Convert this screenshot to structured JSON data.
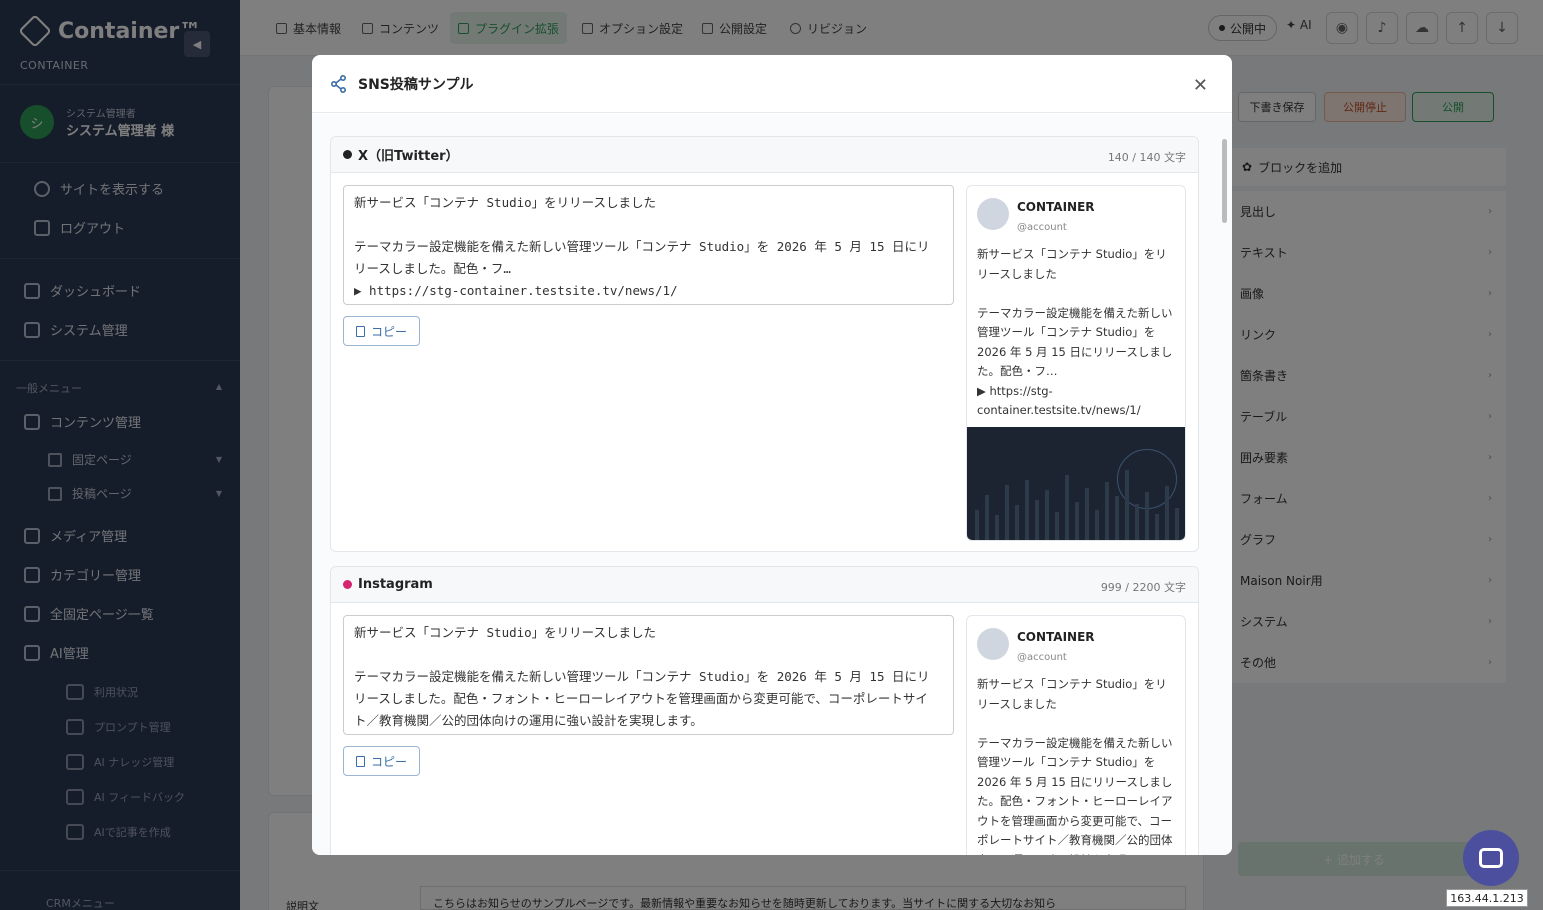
{
  "app": {
    "logo_text": "Container™",
    "logo_sub": "CONTAINER"
  },
  "user": {
    "role": "システム管理者",
    "name": "システム管理者 様",
    "avatar_char": "シ"
  },
  "sidebar": {
    "top_links": [
      {
        "label": "サイトを表示する"
      },
      {
        "label": "ログアウト"
      }
    ],
    "main_items": [
      {
        "label": "ダッシュボード"
      },
      {
        "label": "システム管理"
      }
    ],
    "group_label": "一般メニュー",
    "menu": [
      {
        "label": "コンテンツ管理"
      },
      {
        "label": "固定ページ"
      },
      {
        "label": "投稿ページ"
      },
      {
        "label": "メディア管理"
      },
      {
        "label": "カテゴリー管理"
      },
      {
        "label": "全固定ページ一覧"
      },
      {
        "label": "AI管理"
      },
      {
        "label": "利用状況"
      },
      {
        "label": "プロンプト管理"
      },
      {
        "label": "AI ナレッジ管理"
      },
      {
        "label": "AI フィードバック"
      },
      {
        "label": "AIで記事を作成"
      }
    ],
    "crm_label": "CRMメニュー"
  },
  "topbar": {
    "tabs": [
      {
        "label": "基本情報"
      },
      {
        "label": "コンテンツ"
      },
      {
        "label": "プラグイン拡張"
      },
      {
        "label": "オプション設定"
      },
      {
        "label": "公開設定"
      },
      {
        "label": "リビジョン"
      }
    ],
    "status": "公開中",
    "ai_label": "AI"
  },
  "right_panel": {
    "draft_label": "下書き保存",
    "unpublish_label": "公開停止",
    "publish_label": "公開",
    "add_block_label": "ブロックを追加",
    "blocks": [
      {
        "label": "見出し"
      },
      {
        "label": "テキスト"
      },
      {
        "label": "画像"
      },
      {
        "label": "リンク"
      },
      {
        "label": "箇条書き"
      },
      {
        "label": "テーブル"
      },
      {
        "label": "囲み要素"
      },
      {
        "label": "フォーム"
      },
      {
        "label": "グラフ"
      },
      {
        "label": "Maison Noir用"
      },
      {
        "label": "システム"
      },
      {
        "label": "その他"
      }
    ],
    "add_button_label": "+ 追加する"
  },
  "background": {
    "desc_label": "説明文",
    "desc_text": "こちらはお知らせのサンプルページです。最新情報や重要なお知らせを随時更新しております。当サイトに関する大切なお知ら"
  },
  "modal": {
    "title": "SNS投稿サンプル",
    "cards": [
      {
        "platform": "X（旧Twitter）",
        "count": "140 / 140 文字",
        "dot_color": "#222222",
        "text": "新サービス「コンテナ Studio」をリリースしました\n\nテーマカラー設定機能を備えた新しい管理ツール「コンテナ Studio」を 2026 年 5 月 15 日にリリースしました。配色・フ…\n▶ https://stg-container.testsite.tv/news/1/",
        "copy_label": "コピー",
        "preview_name": "CONTAINER",
        "preview_account": "@account",
        "preview_text": "新サービス「コンテナ Studio」をリリースしました\n\nテーマカラー設定機能を備えた新しい管理ツール「コンテナ Studio」を 2026 年 5 月 15 日にリリースしました。配色・フ…\n▶ https://stg-container.testsite.tv/news/1/"
      },
      {
        "platform": "Instagram",
        "count": "999 / 2200 文字",
        "dot_color": "#d6246e",
        "text": "新サービス「コンテナ Studio」をリリースしました\n\nテーマカラー設定機能を備えた新しい管理ツール「コンテナ Studio」を 2026 年 5 月 15 日にリリースしました。配色・フォント・ヒーローレイアウトを管理画面から変更可能で、コーポレートサイト／教育機関／公的団体向けの運用に強い設計を実現します。",
        "copy_label": "コピー",
        "preview_name": "CONTAINER",
        "preview_account": "@account",
        "preview_text": "新サービス「コンテナ Studio」をリリースしました\n\nテーマカラー設定機能を備えた新しい管理ツール「コンテナ Studio」を 2026 年 5 月 15 日にリリースしました。配色・フォント・ヒーローレイアウトを管理画面から変更可能で、コーポレートサイト／教育機関／公的団体向けの運用に強い設計を実現"
      }
    ]
  },
  "ip_tag": "163.44.1.213",
  "colors": {
    "accent": "#2e9e5b",
    "sidebar": "#2c3a55",
    "bot": "#4b4f9e"
  },
  "icons": {
    "share": "share-icon",
    "close": "close-icon",
    "copy": "copy-icon",
    "bot": "chatbot-icon"
  }
}
